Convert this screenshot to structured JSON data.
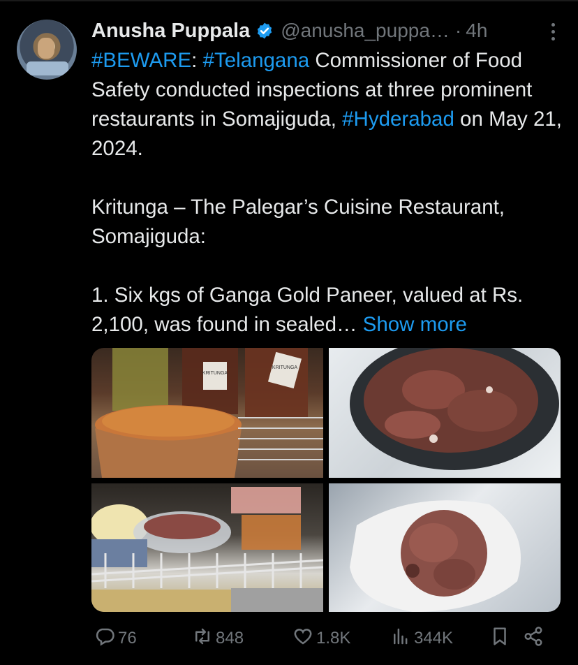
{
  "tweet": {
    "display_name": "Anusha Puppala",
    "handle": "@anusha_puppa…",
    "separator": "·",
    "time": "4h",
    "lines": [
      [
        {
          "t": "#BEWARE",
          "tag": true
        },
        {
          "t": ": "
        },
        {
          "t": "#Telangana",
          "tag": true
        },
        {
          "t": " Commissioner of Food Safety conducted inspections at three prominent restaurants in Somajiguda, "
        },
        {
          "t": "#Hyderabad",
          "tag": true
        },
        {
          "t": " on May 21, 2024."
        }
      ],
      [
        {
          "t": "Kritunga – The Palegar’s Cuisine Restaurant, Somajiguda:"
        }
      ],
      [
        {
          "t": "1. Six kgs of Ganga Gold Paneer, valued at Rs. 2,100, was found in sealed… "
        },
        {
          "t": "Show more",
          "link": true
        }
      ]
    ]
  },
  "media": {
    "label_1": "KRITUNGA",
    "label_2": "KRITUNGA"
  },
  "actions": {
    "replies": "76",
    "reposts": "848",
    "likes": "1.8K",
    "views": "344K"
  },
  "colors": {
    "background": "#000000",
    "text": "#e7e9ea",
    "muted": "#71767b",
    "accent": "#1d9bf0"
  },
  "icons": [
    "verified-badge-icon",
    "more-icon",
    "reply-icon",
    "repost-icon",
    "like-icon",
    "views-icon",
    "bookmark-icon",
    "share-icon"
  ]
}
